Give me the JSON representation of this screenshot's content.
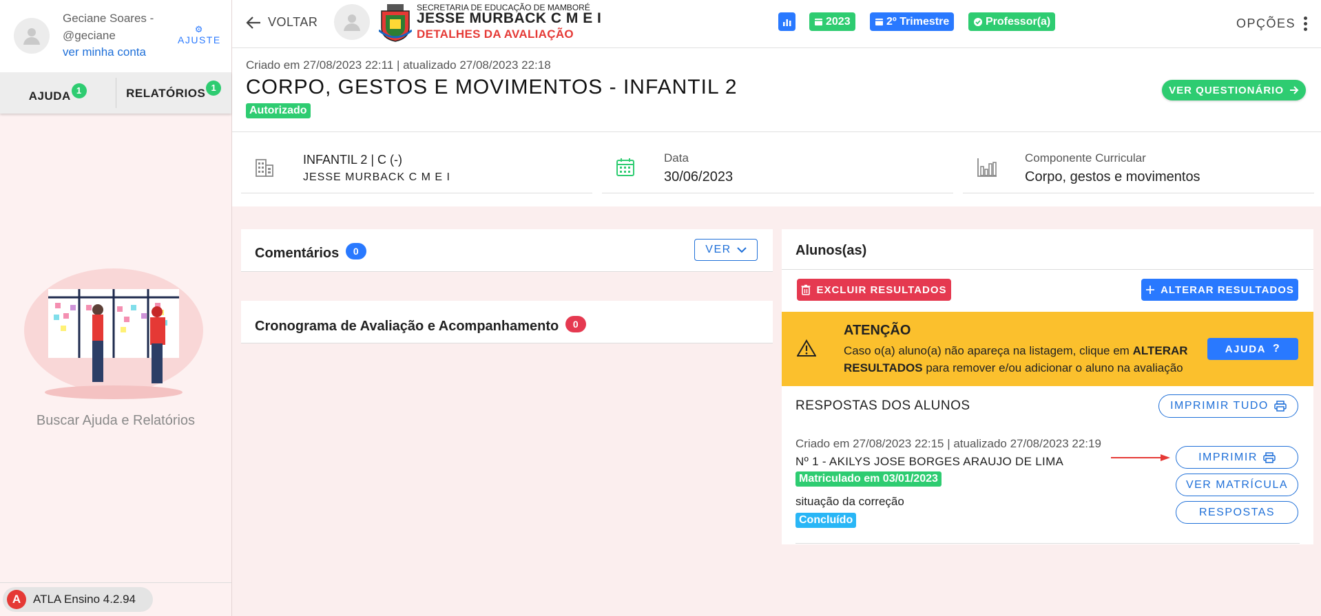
{
  "sidebar": {
    "user_name": "Geciane Soares - @geciane",
    "account_link": "ver minha conta",
    "adjust_label": "AJUSTE",
    "tabs": [
      {
        "label": "AJUDA",
        "count": "1"
      },
      {
        "label": "RELATÓRIOS",
        "count": "1"
      }
    ],
    "help_text": "Buscar Ajuda e Relatórios",
    "version": "ATLA Ensino 4.2.94"
  },
  "topbar": {
    "back_label": "VOLTAR",
    "org_line1": "SECRETARIA DE EDUCAÇÃO DE MAMBORÉ",
    "org_line2": "JESSE MURBACK C M E I",
    "org_line3": "DETALHES DA AVALIAÇÃO",
    "chips": [
      {
        "label": "",
        "icon": "chart-icon",
        "color": "#2979ff"
      },
      {
        "label": "2023",
        "icon": "calendar-icon",
        "color": "#2ecc71"
      },
      {
        "label": "2º Trimestre",
        "icon": "calendar-icon",
        "color": "#2979ff"
      },
      {
        "label": "Professor(a)",
        "icon": "check-circle-icon",
        "color": "#2ecc71"
      }
    ],
    "options_label": "OPÇÕES"
  },
  "header": {
    "meta": "Criado em 27/08/2023 22:11 | atualizado 27/08/2023 22:18",
    "title": "CORPO, GESTOS E MOVIMENTOS - INFANTIL 2",
    "status": "Autorizado",
    "questionnaire_button": "VER QUESTIONÁRIO"
  },
  "info": {
    "class_name": "INFANTIL 2 | C (-)",
    "school": "JESSE MURBACK C M E I",
    "date_label": "Data",
    "date_value": "30/06/2023",
    "component_label": "Componente Curricular",
    "component_value": "Corpo, gestos e movimentos"
  },
  "comments": {
    "title": "Comentários",
    "count": "0",
    "view_label": "VER"
  },
  "schedule": {
    "title": "Cronograma de Avaliação e Acompanhamento",
    "count": "0"
  },
  "students": {
    "title": "Alunos(as)",
    "delete_label": "EXCLUIR RESULTADOS",
    "change_label": "ALTERAR RESULTADOS",
    "attention_title": "ATENÇÃO",
    "attention_pre": "Caso o(a) aluno(a) não apareça na listagem, clique em ",
    "attention_bold": "ALTERAR RESULTADOS",
    "attention_post": " para remover e/ou adicionar o aluno na avaliação",
    "help_label": "AJUDA",
    "responses_title": "RESPOSTAS DOS ALUNOS",
    "print_all_label": "IMPRIMIR TUDO",
    "entry": {
      "meta": "Criado em 27/08/2023 22:15 | atualizado 27/08/2023 22:19",
      "name": "Nº 1 - AKILYS JOSE BORGES ARAUJO DE LIMA",
      "enrolled": "Matriculado em 03/01/2023",
      "correction_label": "situação da correção",
      "correction_status": "Concluído",
      "print_label": "IMPRIMIR",
      "view_enrollment_label": "VER MATRÍCULA",
      "answers_label": "RESPOSTAS"
    }
  },
  "colors": {
    "accent_blue": "#2979ff",
    "accent_green": "#2ecc71",
    "danger_red": "#e53950",
    "warning_yellow": "#fbc02d",
    "link_blue": "#1e6fd8",
    "info_cyan": "#29b6f6"
  }
}
